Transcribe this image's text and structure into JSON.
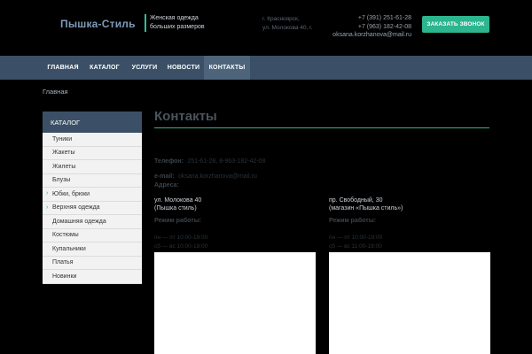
{
  "header": {
    "logo": "Пышка-Стиль",
    "tagline_1": "Женская одежда",
    "tagline_2": "больших размеров",
    "address_1": "г. Красноярск,",
    "address_2": "ул. Молокова 40, г.",
    "phone_1": "+7 (391) 251-61-28",
    "phone_2": "+7 (963) 182-42-08",
    "email": "oksana.korzhanova@mail.ru",
    "callback_label": "Заказать звонок"
  },
  "nav": {
    "items": [
      {
        "label": "Главная"
      },
      {
        "label": "Каталог"
      },
      {
        "label": "Услуги"
      },
      {
        "label": "Новости"
      },
      {
        "label": "Контакты"
      }
    ]
  },
  "breadcrumb": "Главная",
  "sidebar": {
    "title": "Каталог",
    "items": [
      {
        "label": "Туники"
      },
      {
        "label": "Жакеты"
      },
      {
        "label": "Жилеты"
      },
      {
        "label": "Блузы"
      },
      {
        "label": "Юбки, брюки"
      },
      {
        "label": "Верхняя одежда"
      },
      {
        "label": "Домашняя одежда"
      },
      {
        "label": "Костюмы"
      },
      {
        "label": "Купальники"
      },
      {
        "label": "Платья"
      },
      {
        "label": "Новинки"
      }
    ]
  },
  "main": {
    "title": "Контакты",
    "phone_label": "Телефон:",
    "phone_value": "251-61-28, 8-963-182-42-08",
    "email_label": "e-mail:",
    "email_value": "oksana.korzhanova@mail.ru",
    "address_label": "Адреса:",
    "locations": [
      {
        "line_1": "ул. Молокова  40",
        "line_2": "(Пышка стиль)",
        "hours_label": "Режим работы:",
        "hours_1": "пн — пт 10:00-19:00",
        "hours_2": "сб — вс 10:00-18:00"
      },
      {
        "line_1": "пр. Свободный, 30",
        "line_2": "(магазин «Пышка стиль»)",
        "hours_label": "Режим работы:",
        "hours_1": "пн — пт 10:00-19:00",
        "hours_2": "сб — вс 11:00-18:00"
      }
    ]
  },
  "colors": {
    "accent": "#2cb58e",
    "nav_bg": "#3b5066",
    "nav_active": "#4d647b",
    "page_bg": "#000000"
  }
}
